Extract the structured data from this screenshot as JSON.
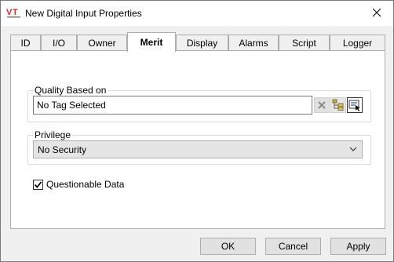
{
  "window": {
    "title": "New Digital Input Properties",
    "app_icon": "vt-logo-icon"
  },
  "tabs": [
    {
      "label": "ID",
      "active": false
    },
    {
      "label": "I/O",
      "active": false
    },
    {
      "label": "Owner",
      "active": false
    },
    {
      "label": "Merit",
      "active": true
    },
    {
      "label": "Display",
      "active": false
    },
    {
      "label": "Alarms",
      "active": false
    },
    {
      "label": "Script",
      "active": false
    },
    {
      "label": "Logger",
      "active": false
    }
  ],
  "quality": {
    "group_label": "Quality Based on",
    "tag_value": "No Tag Selected",
    "clear_icon": "clear-x-icon",
    "browse_icon": "tag-browser-icon",
    "select_icon": "select-tag-icon"
  },
  "privilege": {
    "group_label": "Privilege",
    "selected": "No Security"
  },
  "questionable": {
    "label": "Questionable Data",
    "checked": true
  },
  "buttons": {
    "ok": "OK",
    "cancel": "Cancel",
    "apply": "Apply"
  },
  "colors": {
    "logo_red": "#e0262b",
    "logo_gray": "#777777"
  }
}
